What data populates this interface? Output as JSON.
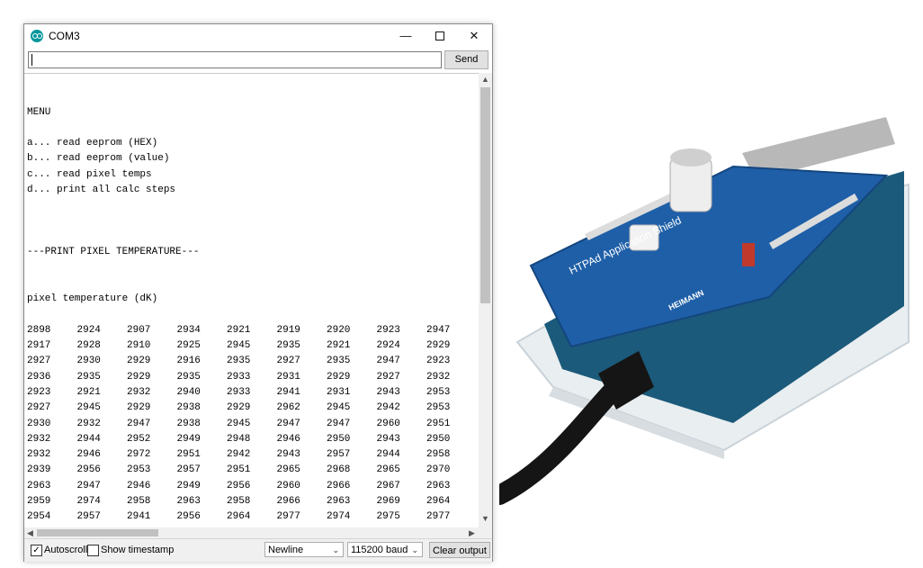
{
  "window": {
    "title": "COM3",
    "controls": {
      "minimize": "—",
      "close": "✕"
    }
  },
  "send_bar": {
    "input_value": "",
    "send_label": "Send"
  },
  "console": {
    "menu_lines": [
      "",
      "",
      "MENU",
      "",
      "a... read eeprom (HEX)",
      "b... read eeprom (value)",
      "c... read pixel temps",
      "d... print all calc steps",
      "",
      "",
      "",
      "---PRINT PIXEL TEMPERATURE---",
      "",
      "",
      "pixel temperature (dK)",
      ""
    ],
    "pixel_rows": [
      [
        "2898",
        "2924",
        "2907",
        "2934",
        "2921",
        "2919",
        "2920",
        "2923",
        "2947"
      ],
      [
        "2917",
        "2928",
        "2910",
        "2925",
        "2945",
        "2935",
        "2921",
        "2924",
        "2929"
      ],
      [
        "2927",
        "2930",
        "2929",
        "2916",
        "2935",
        "2927",
        "2935",
        "2947",
        "2923"
      ],
      [
        "2936",
        "2935",
        "2929",
        "2935",
        "2933",
        "2931",
        "2929",
        "2927",
        "2932"
      ],
      [
        "2923",
        "2921",
        "2932",
        "2940",
        "2933",
        "2941",
        "2931",
        "2943",
        "2953"
      ],
      [
        "2927",
        "2945",
        "2929",
        "2938",
        "2929",
        "2962",
        "2945",
        "2942",
        "2953"
      ],
      [
        "2930",
        "2932",
        "2947",
        "2938",
        "2945",
        "2947",
        "2947",
        "2960",
        "2951"
      ],
      [
        "2932",
        "2944",
        "2952",
        "2949",
        "2948",
        "2946",
        "2950",
        "2943",
        "2950"
      ],
      [
        "2932",
        "2946",
        "2972",
        "2951",
        "2942",
        "2943",
        "2957",
        "2944",
        "2958"
      ],
      [
        "2939",
        "2956",
        "2953",
        "2957",
        "2951",
        "2965",
        "2968",
        "2965",
        "2970"
      ],
      [
        "2963",
        "2947",
        "2946",
        "2949",
        "2956",
        "2960",
        "2966",
        "2967",
        "2963"
      ],
      [
        "2959",
        "2974",
        "2958",
        "2963",
        "2958",
        "2966",
        "2963",
        "2969",
        "2964"
      ],
      [
        "2954",
        "2957",
        "2941",
        "2956",
        "2964",
        "2977",
        "2974",
        "2975",
        "2977"
      ]
    ],
    "clipped_tail": ":"
  },
  "status_bar": {
    "autoscroll_label": "Autoscroll",
    "autoscroll_checked": true,
    "timestamp_label": "Show timestamp",
    "timestamp_checked": false,
    "line_ending": "Newline",
    "baud_rate": "115200 baud",
    "clear_label": "Clear output"
  },
  "photo": {
    "board_text": "HTPAd Application Shield",
    "board_brand": "HEIMANN",
    "board_color": "#1f5fa8",
    "base_board_color": "#1b5a7a",
    "case_color": "#e9eef1",
    "cable_color": "#151515"
  },
  "colors": {
    "app_accent": "#00979c",
    "scroll_thumb": "#c1c1c1",
    "status_bg": "#f0f0f0"
  }
}
